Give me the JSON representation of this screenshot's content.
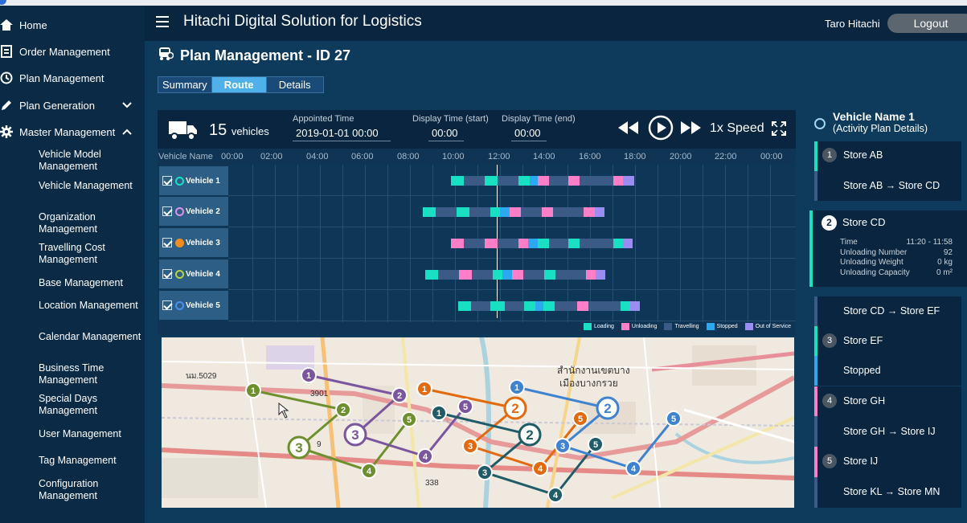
{
  "header": {
    "title": "Hitachi Digital Solution for Logistics",
    "user": "Taro Hitachi",
    "logout_label": "Logout"
  },
  "sidebar": {
    "items": [
      {
        "label": "Home"
      },
      {
        "label": "Order Management"
      },
      {
        "label": "Plan Management"
      },
      {
        "label": "Plan Generation"
      },
      {
        "label": "Master Management"
      }
    ],
    "sub_items": [
      {
        "label": "Vehicle Model Management"
      },
      {
        "label": "Vehicle Management"
      },
      {
        "label": "Organization Management"
      },
      {
        "label": "Travelling Cost Management"
      },
      {
        "label": "Base Management"
      },
      {
        "label": "Location Management"
      },
      {
        "label": "Calendar Management"
      },
      {
        "label": "Business Time Management"
      },
      {
        "label": "Special Days Management"
      },
      {
        "label": "User Management"
      },
      {
        "label": "Tag Management"
      },
      {
        "label": "Configuration Management"
      }
    ]
  },
  "page": {
    "title": "Plan Management - ID 27",
    "tabs": [
      {
        "label": "Summary",
        "active": false
      },
      {
        "label": "Route",
        "active": true
      },
      {
        "label": "Details",
        "active": false
      }
    ]
  },
  "gantt": {
    "vehicle_count": "15",
    "vehicle_unit": "vehicles",
    "appointed_time_label": "Appointed Time",
    "appointed_time": "2019-01-01 00:00",
    "display_start_label": "Display Time (start)",
    "display_start": "00:00",
    "display_end_label": "Display Time (end)",
    "display_end": "00:00",
    "speed": "1x Speed",
    "axis_label": "Vehicle Name",
    "hours": [
      "00:00",
      "02:00",
      "04:00",
      "06:00",
      "08:00",
      "10:00",
      "12:00",
      "14:00",
      "16:00",
      "18:00",
      "20:00",
      "22:00",
      "00:00"
    ],
    "vehicles": [
      {
        "name": "Vehicle 1",
        "color": "#19e0c2"
      },
      {
        "name": "Vehicle 2",
        "color": "#e38ee6"
      },
      {
        "name": "Vehicle 3",
        "color": "#f28c1f"
      },
      {
        "name": "Vehicle 4",
        "color": "#b9d23c"
      },
      {
        "name": "Vehicle 5",
        "color": "#4b8ff0"
      }
    ],
    "legend": [
      {
        "label": "Loading",
        "color": "#19e0c2"
      },
      {
        "label": "Unloading",
        "color": "#ff7ec8"
      },
      {
        "label": "Travelling",
        "color": "#3b5a86"
      },
      {
        "label": "Stopped",
        "color": "#2ba8f0"
      },
      {
        "label": "Out of Service",
        "color": "#9b8cf2"
      }
    ]
  },
  "map": {
    "labels": [
      "นม.5029",
      "3901",
      "สำนักงานเขตบาง",
      "เมืองบางกรวย",
      "338",
      "9"
    ]
  },
  "detail_panel": {
    "vehicle_name": "Vehicle Name 1",
    "subtitle": "(Activity Plan Details)",
    "activities": [
      {
        "num": "1",
        "label": "Store AB",
        "color": "#19e0c2"
      },
      {
        "num": "",
        "label": "Store AB → Store CD",
        "color": "#3b5a86"
      },
      {
        "num": "",
        "label": "Store CD → Store EF",
        "color": "#3b5a86"
      },
      {
        "num": "3",
        "label": "Store EF",
        "color": "#19e0c2"
      },
      {
        "num": "",
        "label": "Stopped",
        "color": "#2ba8f0"
      },
      {
        "num": "4",
        "label": "Store GH",
        "color": "#ff7ec8"
      },
      {
        "num": "",
        "label": "Store GH → Store IJ",
        "color": "#3b5a86"
      },
      {
        "num": "5",
        "label": "Store IJ",
        "color": "#ff7ec8"
      },
      {
        "num": "",
        "label": "Store KL → Store MN",
        "color": "#3b5a86"
      }
    ],
    "selected": {
      "num": "2",
      "name": "Store CD",
      "rows": [
        {
          "label": "Time",
          "value": "11:20 - 11:58"
        },
        {
          "label": "Unloading Number",
          "value": "92"
        },
        {
          "label": "Unloading Weight",
          "value": "0 kg"
        },
        {
          "label": "Unloading Capacity",
          "value": "0 m²"
        }
      ]
    }
  }
}
